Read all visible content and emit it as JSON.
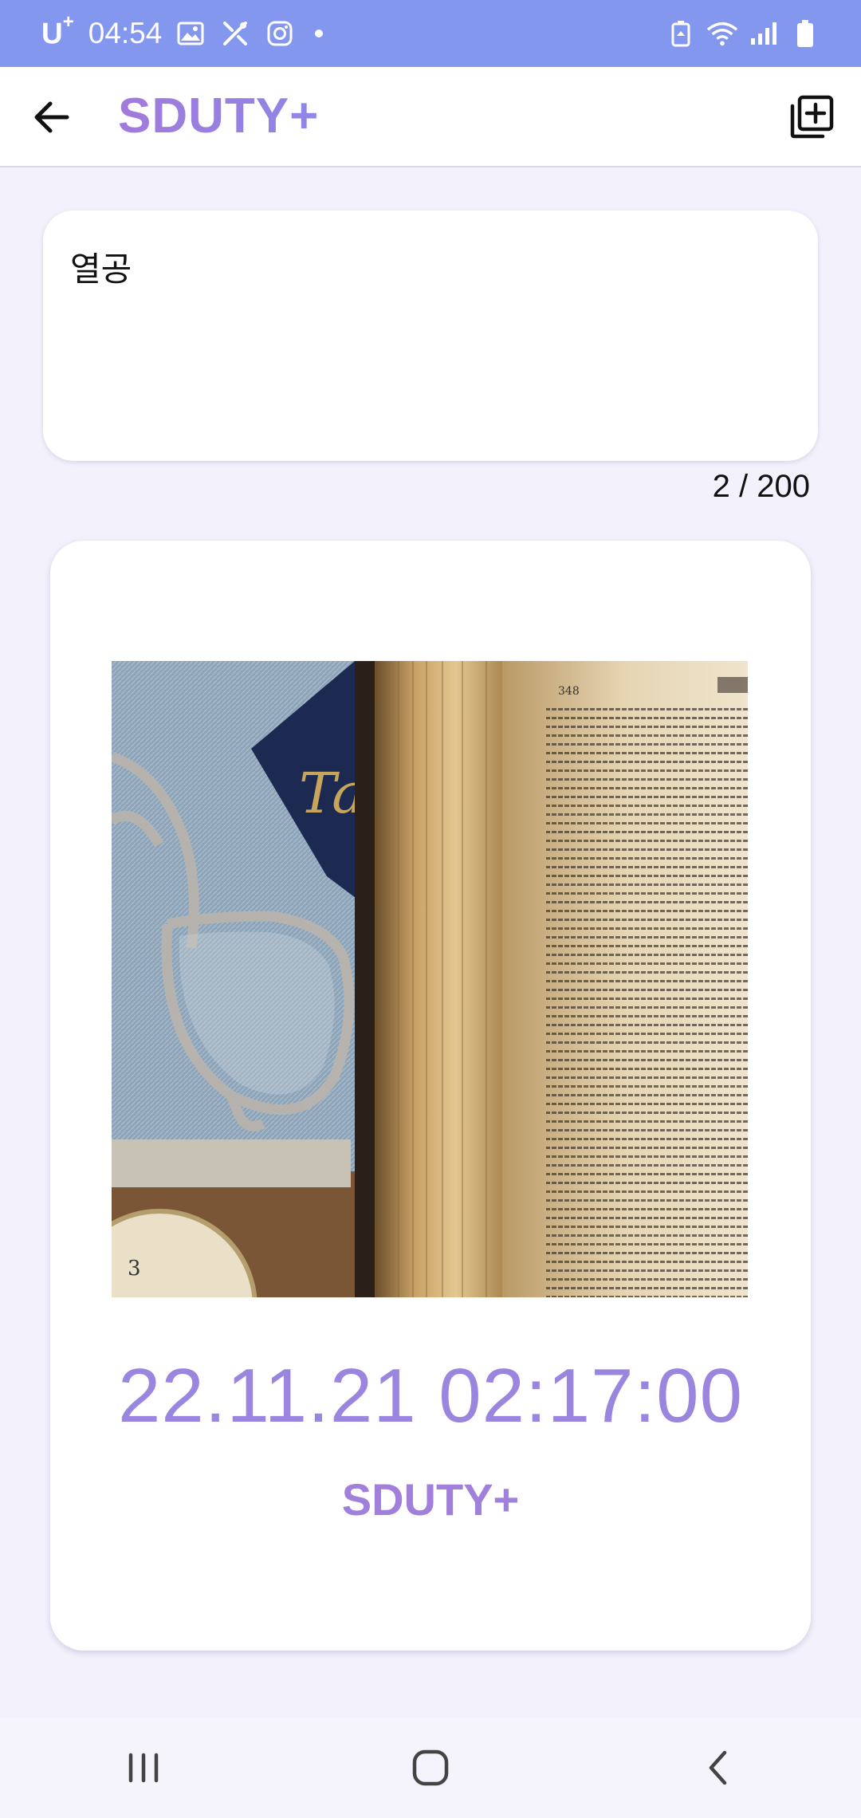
{
  "status_bar": {
    "carrier": "U",
    "carrier_sup": "+",
    "time": "04:54",
    "icons_left": [
      "gallery-icon",
      "tools-icon",
      "instagram-icon",
      "notification-dot"
    ],
    "icons_right": [
      "battery-saver-icon",
      "wifi-icon",
      "signal-icon",
      "battery-icon"
    ],
    "background": "#8497EF"
  },
  "app_bar": {
    "title": "SDUTY+",
    "back_icon": "arrow-back-icon",
    "action_icon": "add-box-icon"
  },
  "memo": {
    "value": "열공",
    "counter": "2 / 200"
  },
  "card": {
    "photo": "open-book-with-glasses-photo",
    "datetime": "22.11.21 02:17:00",
    "brand": "SDUTY+",
    "accent": "#9A86DE"
  },
  "nav_bar": {
    "buttons": [
      "recents-icon",
      "home-icon",
      "back-icon"
    ]
  }
}
